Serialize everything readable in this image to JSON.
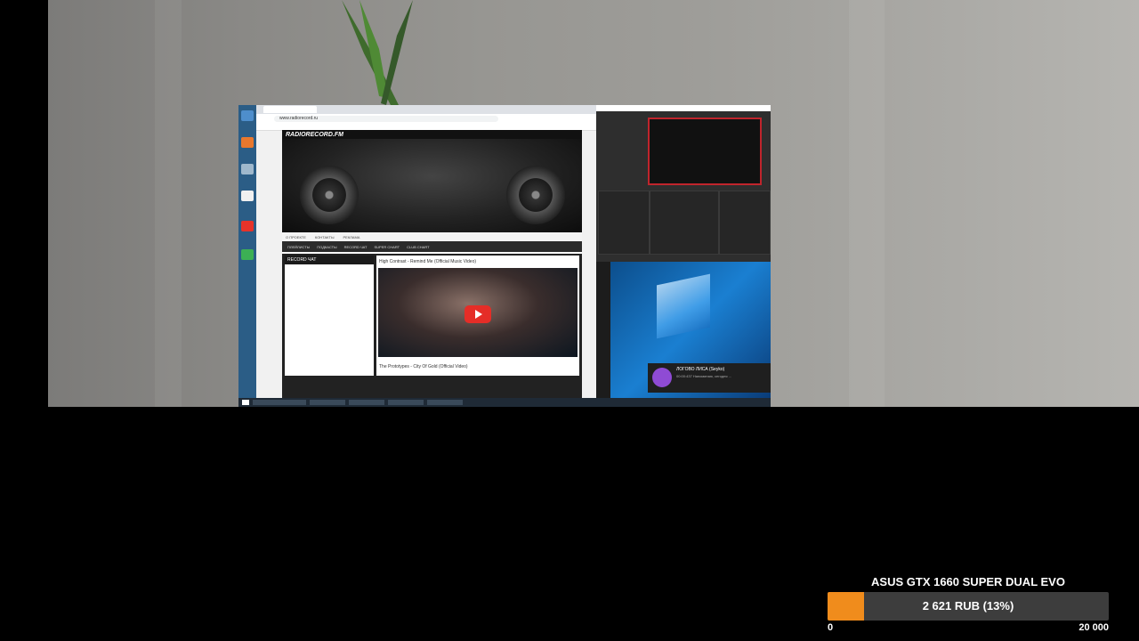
{
  "screen": {
    "browser": {
      "url": "www.radiorecord.ru",
      "site_logo": "RADIORECORD.FM",
      "subnav": [
        "О ПРОЕКТЕ",
        "КОНТАКТЫ",
        "РЕКЛАМА"
      ],
      "mainnav": [
        "ПЛЕЙЛИСТЫ",
        "ПОДКАСТЫ",
        "RECORD ЧАТ",
        "SUPER CHART",
        "CLUB CHART"
      ],
      "chat_title": "RECORD ЧАТ",
      "video_title": "High Contrast - Remind Me (Official Music Video)",
      "video_footer": "The Prototypes - City Of Gold (Official Video)"
    },
    "notification": {
      "title": "ЛОГОВО ЛИСА (Seyko)",
      "text": "00:00:437 Напоминаю, сегодня ..."
    },
    "colors": {
      "obs_border": "#c0242c",
      "youtube": "#e52d27",
      "notif_avatar": "#8f4bd4"
    }
  },
  "donation": {
    "title": "ASUS GTX 1660 SUPER DUAL EVO",
    "progress_label": "2 621 RUB (13%)",
    "progress_fraction": 0.13,
    "min_label": "0",
    "max_label": "20 000",
    "fill_color": "#f08c1c"
  }
}
